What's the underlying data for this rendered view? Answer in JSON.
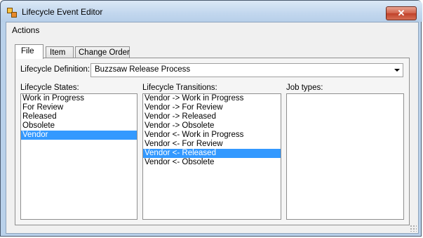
{
  "window": {
    "title": "Lifecycle Event Editor",
    "close_glyph": "✕"
  },
  "menu": {
    "actions_label": "Actions"
  },
  "tabs": [
    {
      "label": "File",
      "active": true
    },
    {
      "label": "Item",
      "active": false
    },
    {
      "label": "Change Order",
      "active": false
    }
  ],
  "definition": {
    "label": "Lifecycle Definition:",
    "value": "Buzzsaw Release Process"
  },
  "states": {
    "label": "Lifecycle States:",
    "items": [
      "Work in Progress",
      "For Review",
      "Released",
      "Obsolete",
      "Vendor"
    ],
    "selected_index": 4
  },
  "transitions": {
    "label": "Lifecycle Transitions:",
    "items": [
      "Vendor -> Work in Progress",
      "Vendor -> For Review",
      "Vendor -> Released",
      "Vendor -> Obsolete",
      "Vendor <- Work in Progress",
      "Vendor <- For Review",
      "Vendor <- Released",
      "Vendor <- Obsolete"
    ],
    "selected_index": 6
  },
  "job_types": {
    "label": "Job types:",
    "items": []
  },
  "colors": {
    "selection": "#3399ff",
    "titlebar": "#c2d7ee",
    "close": "#c0412a"
  }
}
